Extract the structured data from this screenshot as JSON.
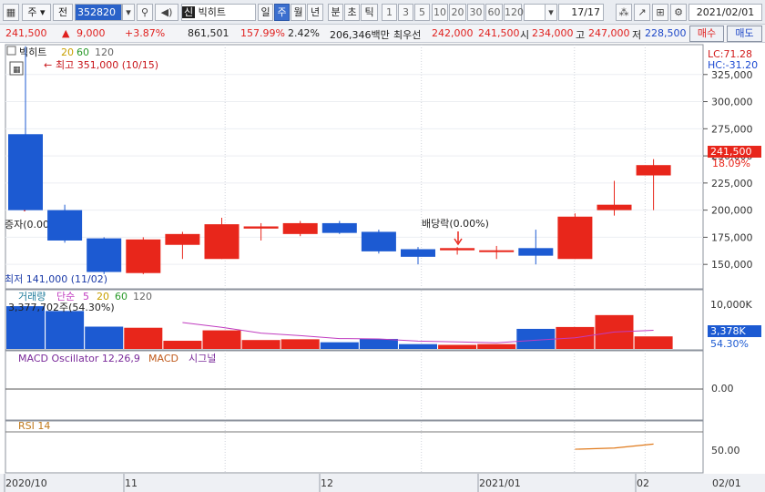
{
  "toolbar": {
    "period_type": "주",
    "prev_label": "전",
    "code": "352820",
    "stock_name": "빅히트",
    "stock_badge": "신",
    "timeframes": [
      "일",
      "주",
      "월",
      "년",
      "분",
      "초",
      "틱"
    ],
    "selected_timeframe": "주",
    "intervals": [
      "1",
      "3",
      "5",
      "10",
      "20",
      "30",
      "60",
      "120"
    ],
    "page": "17",
    "page_total": "/17",
    "date": "2021/02/01"
  },
  "quote": {
    "price": "241,500",
    "change": "9,000",
    "change_pct": "+3.87%",
    "volume": "861,501",
    "volume_ratio": "157.99%",
    "turnover_pct": "2.42%",
    "amount": "206,346백만",
    "priority_label": "최우선",
    "ask": "242,000",
    "bid": "241,500",
    "open_label": "시",
    "open": "234,000",
    "high_label": "고",
    "high": "247,000",
    "low_label": "저",
    "low": "228,500",
    "buy_label": "매수",
    "sell_label": "매도"
  },
  "price_panel": {
    "name": "빅히트",
    "ma": [
      "20",
      "60",
      "120"
    ],
    "lc": "LC:71.28",
    "hc": "HC:-31.20",
    "high_note": "최고 351,000 (10/15)",
    "low_note": "최저 141,000 (11/02)",
    "capital_increase": "증자(0.00%)",
    "dividend": "배당락(0.00%)",
    "last_label": "241,500",
    "last_pct": "18.09%",
    "y_ticks": [
      "325,000",
      "300,000",
      "275,000",
      "250,000",
      "225,000",
      "200,000",
      "175,000",
      "150,000"
    ]
  },
  "volume_panel": {
    "title": "거래량",
    "ma_label": "단순",
    "ma": [
      "5",
      "20",
      "60",
      "120"
    ],
    "info": "3,377,702주(54.30%)",
    "y_tick": "10,000K",
    "last_label": "3,378K",
    "last_pct": "54.30%"
  },
  "macd_panel": {
    "title": "MACD Oscillator 12,26,9",
    "macd": "MACD",
    "signal": "시그널",
    "y_tick": "0.00"
  },
  "rsi_panel": {
    "title": "RSI 14",
    "y_tick": "50.00"
  },
  "x_labels": [
    "2020/10",
    "11",
    "12",
    "2021/01",
    "02",
    "02/01"
  ],
  "colors": {
    "up": "#e8261b",
    "down": "#1c5ad2",
    "ma": "#c03cc0",
    "rsi": "#e07a1c"
  },
  "chart_data": {
    "type": "candlestick",
    "x": [
      "10/12",
      "10/19",
      "10/26",
      "11/02",
      "11/09",
      "11/16",
      "11/23",
      "11/30",
      "12/07",
      "12/14",
      "12/21",
      "12/28",
      "01/04",
      "01/11",
      "01/18",
      "01/25",
      "02/01"
    ],
    "open": [
      270000,
      200000,
      174000,
      142000,
      168000,
      155000,
      183000,
      178000,
      188000,
      180000,
      164000,
      163000,
      163000,
      165000,
      155000,
      200000,
      232000
    ],
    "high": [
      351000,
      205000,
      175000,
      175000,
      180000,
      193000,
      188000,
      190000,
      190000,
      182000,
      166000,
      166000,
      167000,
      182000,
      197000,
      227000,
      247000
    ],
    "low": [
      200000,
      170000,
      141000,
      141000,
      155000,
      155000,
      172000,
      176000,
      178000,
      160000,
      150000,
      159000,
      155000,
      150000,
      155000,
      195000,
      200000
    ],
    "close": [
      200000,
      172000,
      143000,
      173000,
      178000,
      187000,
      185000,
      188000,
      179000,
      162000,
      157000,
      165000,
      163000,
      158000,
      194000,
      205000,
      241500
    ],
    "volume_k": [
      11500,
      10200,
      6000,
      5700,
      2200,
      5000,
      2400,
      2600,
      1800,
      2700,
      1300,
      1100,
      1300,
      5400,
      5900,
      9100,
      3378
    ],
    "volume_ma5_k": [
      null,
      null,
      null,
      null,
      7100,
      5820,
      4260,
      3580,
      2800,
      2700,
      2100,
      1900,
      1640,
      2360,
      3000,
      4560,
      5015
    ],
    "rsi": [
      null,
      null,
      null,
      null,
      null,
      null,
      null,
      null,
      null,
      null,
      null,
      null,
      null,
      null,
      43,
      46,
      56
    ],
    "ylim_price": [
      130000,
      350000
    ],
    "ylim_volume_k": [
      0,
      12000
    ]
  }
}
